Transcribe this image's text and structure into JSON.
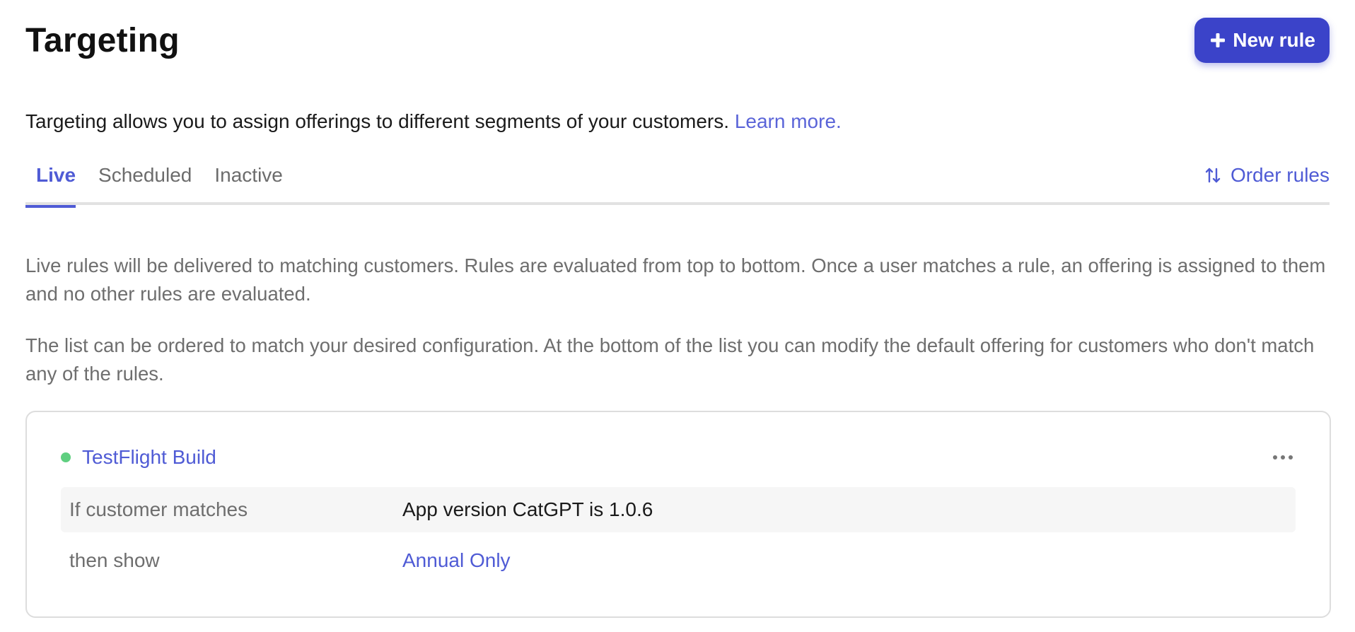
{
  "header": {
    "title": "Targeting",
    "new_rule_label": "New rule",
    "new_rule_icon": "plus-icon"
  },
  "description": {
    "text": "Targeting allows you to assign offerings to different segments of your customers.",
    "learn_more": "Learn more."
  },
  "tabs": [
    {
      "label": "Live",
      "active": true
    },
    {
      "label": "Scheduled",
      "active": false
    },
    {
      "label": "Inactive",
      "active": false
    }
  ],
  "order_rules": {
    "label": "Order rules",
    "icon": "sort-arrows-icon"
  },
  "info": {
    "paragraph1": "Live rules will be delivered to matching customers. Rules are evaluated from top to bottom. Once a user matches a rule, an offering is assigned to them and no other rules are evaluated.",
    "paragraph2": "The list can be ordered to match your desired configuration. At the bottom of the list you can modify the default offering for customers who don't match any of the rules."
  },
  "rule": {
    "name": "TestFlight Build",
    "status_color": "#5fcf80",
    "condition_label": "If customer matches",
    "condition_value": "App version CatGPT is 1.0.6",
    "offering_label": "then show",
    "offering_value": "Annual Only"
  },
  "colors": {
    "accent": "#4f5bd5",
    "button": "#3b43c9",
    "muted_text": "#6e6e6e"
  }
}
